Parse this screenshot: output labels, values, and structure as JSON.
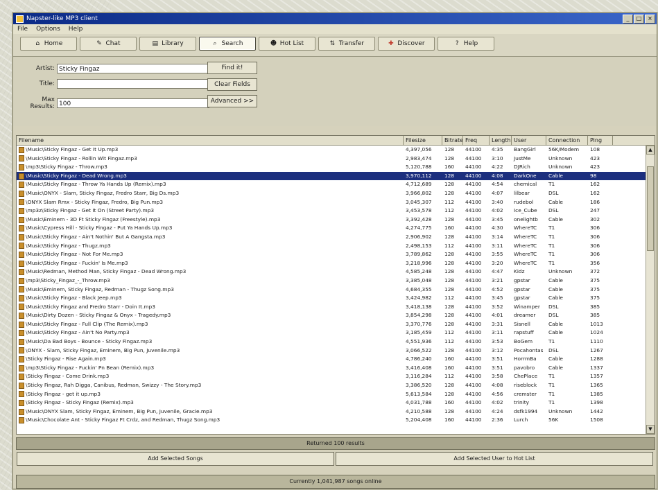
{
  "window": {
    "title": "Napster-like MP3 client",
    "controls": [
      "_",
      "□",
      "×"
    ]
  },
  "menu": [
    "File",
    "Options",
    "Help"
  ],
  "toolbar": [
    {
      "label": "Home",
      "icon": "home-icon"
    },
    {
      "label": "Chat",
      "icon": "chat-icon"
    },
    {
      "label": "Library",
      "icon": "library-icon"
    },
    {
      "label": "Search",
      "icon": "search-icon",
      "active": true
    },
    {
      "label": "Hot List",
      "icon": "hotlist-icon"
    },
    {
      "label": "Transfer",
      "icon": "transfer-icon"
    },
    {
      "label": "Discover",
      "icon": "discover-icon"
    },
    {
      "label": "Help",
      "icon": "help-icon"
    }
  ],
  "search": {
    "artist_label": "Artist:",
    "artist_value": "Sticky Fingaz",
    "title_label": "Title:",
    "title_value": "",
    "max_label": "Max Results:",
    "max_value": "100",
    "find_button": "Find it!",
    "clear_button": "Clear Fields",
    "advanced_button": "Advanced >>"
  },
  "table": {
    "columns": [
      "Filename",
      "Filesize",
      "Bitrate",
      "Freq",
      "Length",
      "User",
      "Connection",
      "Ping"
    ],
    "rows": [
      [
        "\\Music\\Sticky Fingaz - Get It Up.mp3",
        "4,397,056",
        "128",
        "44100",
        "4:35",
        "BangGirl",
        "56K/Modem",
        "108"
      ],
      [
        "\\Music\\Sticky Fingaz - Rollin Wit Fingaz.mp3",
        "2,983,474",
        "128",
        "44100",
        "3:10",
        "JustMe",
        "Unknown",
        "423"
      ],
      [
        "\\mp3\\Sticky Fingaz - Throw.mp3",
        "5,120,788",
        "160",
        "44100",
        "4:22",
        "DJRich",
        "Unknown",
        "423"
      ],
      [
        "\\Music\\Sticky Fingaz - Dead Wrong.mp3",
        "3,970,112",
        "128",
        "44100",
        "4:08",
        "DarkOne",
        "Cable",
        "98"
      ],
      [
        "\\Music\\Sticky Fingaz - Throw Ya Hands Up (Remix).mp3",
        "4,712,689",
        "128",
        "44100",
        "4:54",
        "chemical",
        "T1",
        "162"
      ],
      [
        "\\Music\\ONYX - Slam, Sticky Fingaz, Fredro Starr, Big Ds.mp3",
        "3,966,802",
        "128",
        "44100",
        "4:07",
        "lilbear",
        "DSL",
        "162"
      ],
      [
        "\\ONYX Slam Rmx - Sticky Fingaz, Fredro, Big Pun.mp3",
        "3,045,307",
        "112",
        "44100",
        "3:40",
        "rudebol",
        "Cable",
        "186"
      ],
      [
        "\\mp3z\\Sticky Fingaz - Get It On (Street Party).mp3",
        "3,453,578",
        "112",
        "44100",
        "4:02",
        "Ice_Cube",
        "DSL",
        "247"
      ],
      [
        "\\Music\\Eminem - 3D Ft Sticky Fingaz (Freestyle).mp3",
        "3,392,428",
        "128",
        "44100",
        "3:45",
        "onelightb",
        "Cable",
        "302"
      ],
      [
        "\\Music\\Cypress Hill - Sticky Fingaz - Put Ya Hands Up.mp3",
        "4,274,775",
        "160",
        "44100",
        "4:30",
        "WhereTC",
        "T1",
        "306"
      ],
      [
        "\\Music\\Sticky Fingaz - Ain't Nothin' But A Gangsta.mp3",
        "2,906,902",
        "128",
        "44100",
        "3:14",
        "WhereTC",
        "T1",
        "306"
      ],
      [
        "\\Music\\Sticky Fingaz - Thugz.mp3",
        "2,498,153",
        "112",
        "44100",
        "3:11",
        "WhereTC",
        "T1",
        "306"
      ],
      [
        "\\Music\\Sticky Fingaz - Not For Me.mp3",
        "3,789,862",
        "128",
        "44100",
        "3:55",
        "WhereTC",
        "T1",
        "306"
      ],
      [
        "\\Music\\Sticky Fingaz - Fuckin' Is Me.mp3",
        "3,218,996",
        "128",
        "44100",
        "3:20",
        "WhereTC",
        "T1",
        "356"
      ],
      [
        "\\Music\\Redman, Method Man, Sticky Fingaz - Dead Wrong.mp3",
        "4,585,248",
        "128",
        "44100",
        "4:47",
        "Kidz",
        "Unknown",
        "372"
      ],
      [
        "\\mp3\\Sticky_Fingaz_-_Throw.mp3",
        "3,385,048",
        "128",
        "44100",
        "3:21",
        "gpstar",
        "Cable",
        "375"
      ],
      [
        "\\Music\\Eminem, Sticky Fingaz, Redman - Thugz Song.mp3",
        "4,684,355",
        "128",
        "44100",
        "4:52",
        "gpstar",
        "Cable",
        "375"
      ],
      [
        "\\Music\\Sticky Fingaz - Black Jeep.mp3",
        "3,424,982",
        "112",
        "44100",
        "3:45",
        "gpstar",
        "Cable",
        "375"
      ],
      [
        "\\Music\\Sticky Fingaz and Fredro Starr - Doin It.mp3",
        "3,418,138",
        "128",
        "44100",
        "3:52",
        "Winamper",
        "DSL",
        "385"
      ],
      [
        "\\Music\\Dirty Dozen - Sticky Fingaz & Onyx - Tragedy.mp3",
        "3,854,298",
        "128",
        "44100",
        "4:01",
        "dreamer",
        "DSL",
        "385"
      ],
      [
        "\\Music\\Sticky Fingaz - Full Clip (The Remix).mp3",
        "3,370,776",
        "128",
        "44100",
        "3:31",
        "Sisnell",
        "Cable",
        "1013"
      ],
      [
        "\\Music\\Sticky Fingaz - Ain't No Party.mp3",
        "3,185,459",
        "112",
        "44100",
        "3:11",
        "rapstuff",
        "Cable",
        "1024"
      ],
      [
        "\\Music\\Da Bad Boys - Bounce - Sticky Fingaz.mp3",
        "4,551,936",
        "112",
        "44100",
        "3:53",
        "BoGem",
        "T1",
        "1110"
      ],
      [
        "\\ONYX - Slam, Sticky Fingaz, Eminem, Big Pun, Juvenile.mp3",
        "3,066,522",
        "128",
        "44100",
        "3:12",
        "Pocahontas",
        "DSL",
        "1267"
      ],
      [
        "\\Sticky Fingaz - Rise Again.mp3",
        "4,786,240",
        "160",
        "44100",
        "3:51",
        "HorrmBa",
        "Cable",
        "1288"
      ],
      [
        "\\mp3\\Sticky Fingaz - Fuckin' Pn Bean (Remix).mp3",
        "3,416,408",
        "160",
        "44100",
        "3:51",
        "pavobro",
        "Cable",
        "1337"
      ],
      [
        "\\Sticky Fingaz - Come Drink.mp3",
        "3,116,284",
        "112",
        "44100",
        "3:58",
        "ChePlace",
        "T1",
        "1357"
      ],
      [
        "\\Sticky Fingaz, Rah Digga, Canibus, Redman, Swizzy - The Story.mp3",
        "3,386,520",
        "128",
        "44100",
        "4:08",
        "riseblock",
        "T1",
        "1365"
      ],
      [
        "\\Sticky Fingaz - get it up.mp3",
        "5,613,584",
        "128",
        "44100",
        "4:56",
        "cremster",
        "T1",
        "1385"
      ],
      [
        "\\Sticky Fingaz - Sticky Fingaz (Remix).mp3",
        "4,031,788",
        "160",
        "44100",
        "4:02",
        "trinity",
        "T1",
        "1398"
      ],
      [
        "\\Music\\ONYX Slam, Sticky Fingaz, Eminem, Big Pun, Juvenile, Gracie.mp3",
        "4,210,588",
        "128",
        "44100",
        "4:24",
        "dsfk1994",
        "Unknown",
        "1442"
      ],
      [
        "\\Music\\Chocolate Ant - Sticky Fingaz Ft Crdz, and Redman, Thugz Song.mp3",
        "5,204,408",
        "160",
        "44100",
        "2:36",
        "Lurch",
        "56K",
        "1508"
      ]
    ],
    "selected_row": 3
  },
  "status": {
    "results": "Returned 100 results",
    "add_button": "Add Selected Songs",
    "add_hotlist_button": "Add Selected User to Hot List",
    "footer": "Currently 1,041,987 songs online"
  }
}
